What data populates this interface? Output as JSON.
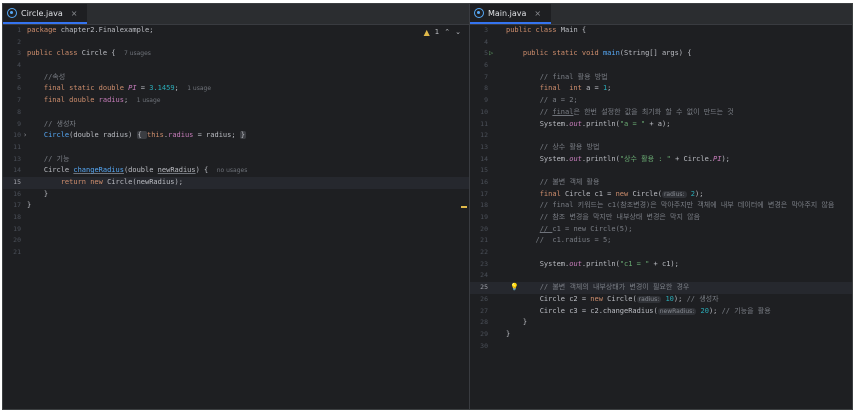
{
  "left_pane": {
    "tab": {
      "filename": "Circle.java",
      "close": "×"
    },
    "inspection": {
      "warnings": "1",
      "up": "⌃",
      "down": "⌄"
    },
    "lines": [
      {
        "n": "1"
      },
      {
        "n": "2"
      },
      {
        "n": "3"
      },
      {
        "n": "4"
      },
      {
        "n": "5"
      },
      {
        "n": "6"
      },
      {
        "n": "7"
      },
      {
        "n": "8"
      },
      {
        "n": "9"
      },
      {
        "n": "10"
      },
      {
        "n": "11"
      },
      {
        "n": "13"
      },
      {
        "n": "14"
      },
      {
        "n": "15"
      },
      {
        "n": "16"
      },
      {
        "n": "17"
      },
      {
        "n": "18"
      },
      {
        "n": "19"
      },
      {
        "n": "20"
      },
      {
        "n": "21"
      }
    ],
    "t": {
      "l1_a": "package ",
      "l1_b": "chapter2.Finalexample;",
      "l3_a": "public class ",
      "l3_b": "Circle {",
      "l3_hint": "7 usages",
      "l5": "//속성",
      "l6_a": "final static double ",
      "l6_b": "PI",
      "l6_c": " = ",
      "l6_d": "3.1459",
      "l6_e": ";",
      "l6_hint": "1 usage",
      "l7_a": "final double ",
      "l7_b": "radius",
      "l7_c": ";",
      "l7_hint": "1 usage",
      "l9": "// 생성자",
      "l10_a": "Circle",
      "l10_b": "(double radius) ",
      "l10_c": "{ ",
      "l10_d": "this",
      "l10_e": ".",
      "l10_f": "radius",
      "l10_g": " = radius; ",
      "l10_h": "}",
      "l14": "// 기능",
      "l15_a": "Circle ",
      "l15_b": "changeRadius",
      "l15_c": "(double ",
      "l15_d": "newRadius",
      "l15_e": ") {",
      "l15_hint": "no usages",
      "l16_a": "return new ",
      "l16_b": "Circle(newRadius);",
      "l17": "}",
      "l18": "}"
    }
  },
  "right_pane": {
    "tab": {
      "filename": "Main.java",
      "close": "×"
    },
    "menu": "⋮",
    "lines": [
      {
        "n": "3"
      },
      {
        "n": "4"
      },
      {
        "n": "5"
      },
      {
        "n": "6"
      },
      {
        "n": "7"
      },
      {
        "n": "8"
      },
      {
        "n": "9"
      },
      {
        "n": "10"
      },
      {
        "n": "11"
      },
      {
        "n": "12"
      },
      {
        "n": "13"
      },
      {
        "n": "14"
      },
      {
        "n": "15"
      },
      {
        "n": "16"
      },
      {
        "n": "17"
      },
      {
        "n": "18"
      },
      {
        "n": "19"
      },
      {
        "n": "20"
      },
      {
        "n": "21"
      },
      {
        "n": "22"
      },
      {
        "n": "23"
      },
      {
        "n": "24"
      },
      {
        "n": "25"
      },
      {
        "n": "26"
      },
      {
        "n": "27"
      },
      {
        "n": "28"
      },
      {
        "n": "29"
      },
      {
        "n": "30"
      }
    ],
    "t": {
      "r3_a": "public class ",
      "r3_b": "Main {",
      "r5_a": "public static void ",
      "r5_b": "main",
      "r5_c": "(String[] args) {",
      "r7": "// final 활용 방법",
      "r8_a": "final  int ",
      "r8_b": "a = ",
      "r8_c": "1",
      "r8_d": ";",
      "r9": "// a = 2;",
      "r10_a": "// ",
      "r10_b": "final",
      "r10_c": "은 한번 설정한 값을 최기화 할 수 없이 만드는 것",
      "r11_a": "System.",
      "r11_b": "out",
      "r11_c": ".println(",
      "r11_d": "\"a = \"",
      "r11_e": " + a);",
      "r13": "// 상수 활용 방법",
      "r14_a": "System.",
      "r14_b": "out",
      "r14_c": ".println(",
      "r14_d": "\"상수 활용 : \"",
      "r14_e": " + Circle.",
      "r14_f": "PI",
      "r14_g": ");",
      "r16": "// 불변 객체 활용",
      "r17_a": "final ",
      "r17_b": "Circle c1 = ",
      "r17_c": "new ",
      "r17_d": "Circle(",
      "r17_e": "radius:",
      "r17_f": " 2",
      "r17_g": ");",
      "r18": "// final 키워드는 c1(참조변경)은 막아주지만 객체에 내부 데이터에 변경은 막아주지 않음",
      "r19": "// 참조 변경을 막지만 내부상태 변경은 막지 않음",
      "r20_a": "// ",
      "r20_b": "c1 = new Circle(5);",
      "r21": "//  c1.radius = 5;",
      "r23_a": "System.",
      "r23_b": "out",
      "r23_c": ".println(",
      "r23_d": "\"c1 = \"",
      "r23_e": " + c1);",
      "r25_icon": "💡",
      "r25": "// 불변 객체의 내부상태가 변경이 필요한 경우",
      "r26_a": "Circle c2 = ",
      "r26_b": "new ",
      "r26_c": "Circle(",
      "r26_d": "radius:",
      "r26_e": " 10",
      "r26_f": "); ",
      "r26_g": "// 생성자",
      "r27_a": "Circle c3 = c2.changeRadius(",
      "r27_b": "newRadius:",
      "r27_c": " 20",
      "r27_d": "); ",
      "r27_e": "// 기능을 활용",
      "r28": "}",
      "r29": "}"
    }
  }
}
